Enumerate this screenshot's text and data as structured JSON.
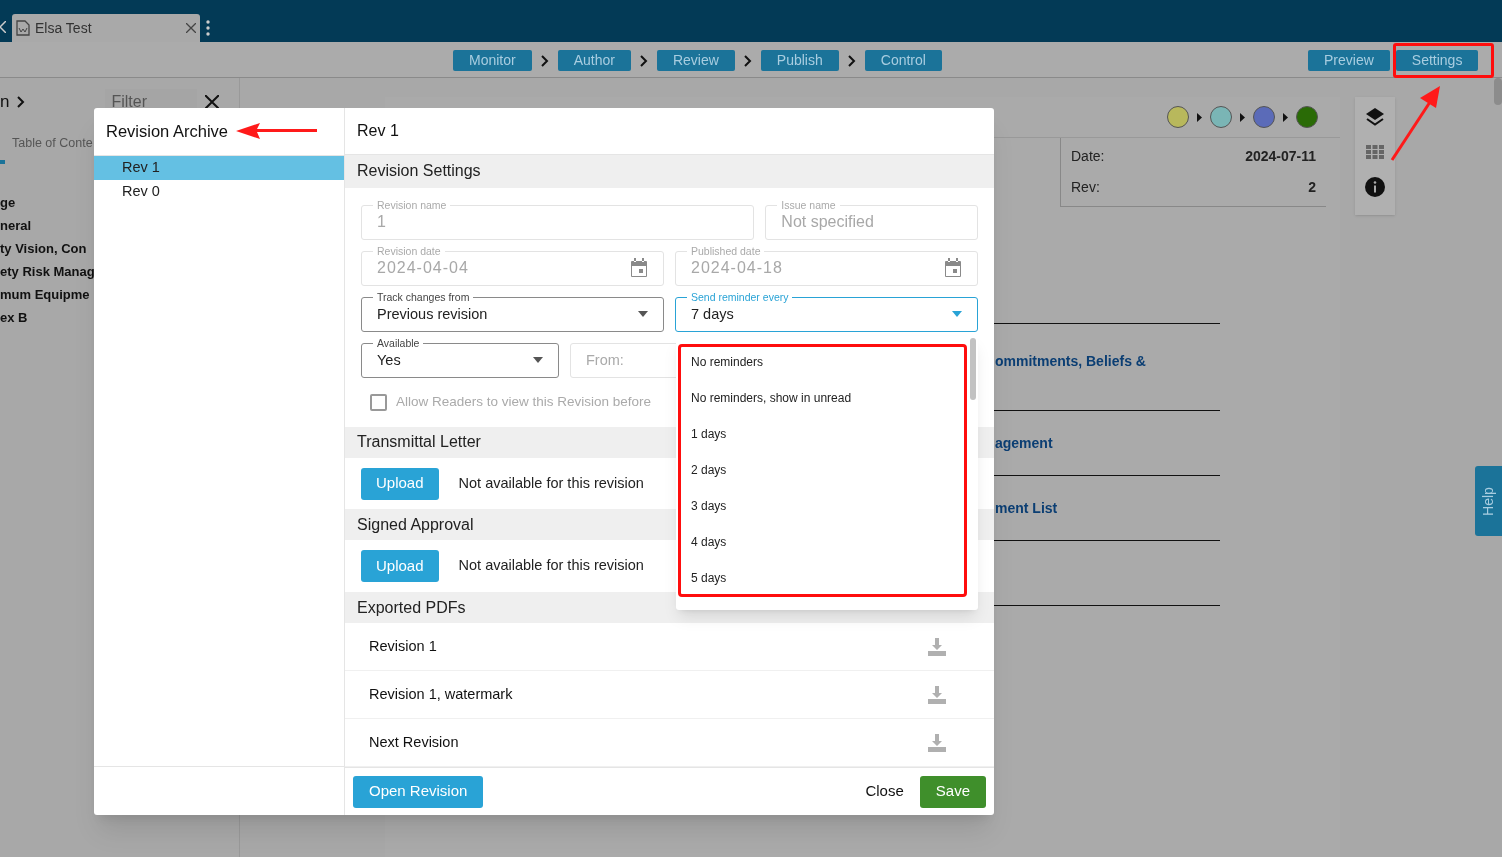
{
  "browser_tab": {
    "title": "Elsa Test"
  },
  "workflow_steps": [
    {
      "label": "Monitor"
    },
    {
      "label": "Author"
    },
    {
      "label": "Review"
    },
    {
      "label": "Publish"
    },
    {
      "label": "Control"
    }
  ],
  "view_buttons": [
    {
      "label": "Preview"
    },
    {
      "label": "Settings"
    }
  ],
  "sidebar": {
    "breadcrumb": "n",
    "filter": {
      "placeholder": "Filter"
    },
    "tab": "Table of Conte",
    "items": [
      "ge",
      "neral",
      "ty Vision, Con",
      "ety Risk Manag",
      "mum Equipme",
      "ex B"
    ]
  },
  "document": {
    "status_dots": [
      {
        "color": "#b8b85c"
      },
      {
        "color": "#7ab5b5"
      },
      {
        "color": "#5b6bb8"
      },
      {
        "color": "#2a6b06"
      }
    ],
    "info": [
      {
        "label": "Date:",
        "value": "2024-07-11"
      },
      {
        "label": "Rev:",
        "value": "2"
      }
    ],
    "links": [
      "ommitments, Beliefs &",
      "agement",
      "ment List"
    ]
  },
  "help_tab": "Help",
  "dialog": {
    "title": "Revision Archive",
    "revisions": [
      {
        "label": "Rev 1",
        "selected": true
      },
      {
        "label": "Rev 0",
        "selected": false
      }
    ],
    "heading": "Rev 1",
    "settings": {
      "title": "Revision Settings",
      "rows": [
        [
          {
            "kind": "text",
            "label": "Revision name",
            "value": "1",
            "disabled": true,
            "focused": false
          },
          {
            "kind": "text",
            "label": "Issue name",
            "value": "Not specified",
            "disabled": true,
            "focused": false
          }
        ],
        [
          {
            "kind": "date",
            "label": "Revision date",
            "value": "2024-04-04",
            "disabled": true,
            "focused": false
          },
          {
            "kind": "date",
            "label": "Published date",
            "value": "2024-04-18",
            "disabled": true,
            "focused": false
          }
        ],
        [
          {
            "kind": "select",
            "label": "Track changes from",
            "value": "Previous revision",
            "disabled": false,
            "focused": false
          },
          {
            "kind": "select",
            "label": "Send reminder every",
            "value": "7 days",
            "disabled": false,
            "focused": true
          }
        ],
        [
          {
            "kind": "select",
            "label": "Available",
            "value": "Yes",
            "disabled": false,
            "focused": false
          },
          {
            "kind": "text",
            "placeholder": "From:",
            "focused": false
          }
        ]
      ],
      "checkbox": {
        "label": "Allow Readers to view this Revision before",
        "checked": false
      }
    },
    "transmittal": {
      "title": "Transmittal Letter",
      "button": "Upload",
      "status": "Not available for this revision"
    },
    "signed_approval": {
      "title": "Signed Approval",
      "button": "Upload",
      "status": "Not available for this revision"
    },
    "exported_pdfs": {
      "title": "Exported PDFs",
      "files": [
        "Revision 1",
        "Revision 1, watermark",
        "Next Revision"
      ]
    },
    "footer": {
      "open": "Open Revision",
      "close": "Close",
      "save": "Save"
    }
  },
  "reminder_menu": {
    "options": [
      "No reminders",
      "No reminders, show in unread",
      "1 days",
      "2 days",
      "3 days",
      "4 days",
      "5 days"
    ]
  }
}
